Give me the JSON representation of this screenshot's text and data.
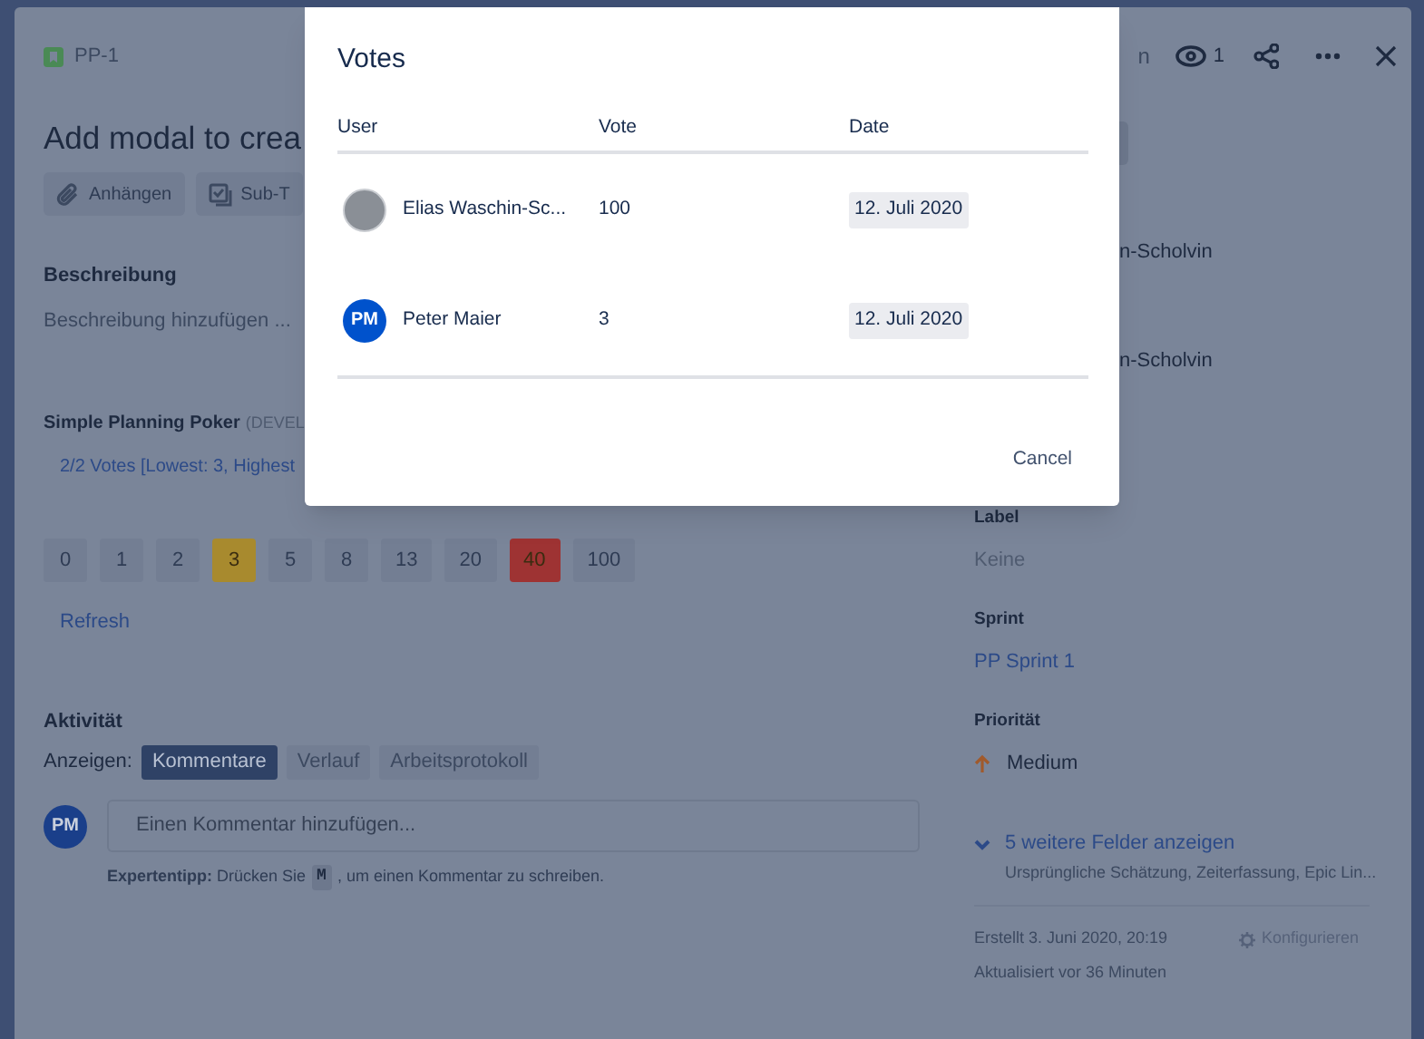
{
  "header": {
    "key": "PP-1",
    "partial_label": "n",
    "watchers": "1"
  },
  "issue": {
    "title": "Add modal to crea",
    "actions": [
      {
        "label": "Anhängen",
        "kind": "attach"
      },
      {
        "label": "Sub-T",
        "kind": "subtask"
      }
    ]
  },
  "description": {
    "heading": "Beschreibung",
    "placeholder": "Beschreibung hinzufügen ..."
  },
  "poker": {
    "heading": "Simple Planning Poker",
    "tag": "(DEVEL",
    "summary": "2/2 Votes [Lowest: 3, Highest",
    "refresh": "Refresh",
    "cards": [
      {
        "label": "0",
        "color": "#737e93"
      },
      {
        "label": "1",
        "color": "#737e93"
      },
      {
        "label": "2",
        "color": "#737e93"
      },
      {
        "label": "3",
        "color": "#a88a2e"
      },
      {
        "label": "5",
        "color": "#737e93"
      },
      {
        "label": "8",
        "color": "#737e93"
      },
      {
        "label": "13",
        "color": "#737e93"
      },
      {
        "label": "20",
        "color": "#737e93"
      },
      {
        "label": "40",
        "color": "#9e3333"
      },
      {
        "label": "100",
        "color": "#737e93"
      }
    ]
  },
  "activity": {
    "heading": "Aktivität",
    "show_label": "Anzeigen:",
    "filters": [
      {
        "label": "Kommentare",
        "selected": true
      },
      {
        "label": "Verlauf",
        "selected": false
      },
      {
        "label": "Arbeitsprotokoll",
        "selected": false
      }
    ],
    "avatar": "PM",
    "comment_placeholder": "Einen Kommentar hinzufügen...",
    "tip": "**Expertentipp:** Drücken Sie",
    "tip_key": "M",
    "tip_rest": ", um einen Kommentar zu schreiben."
  },
  "sidebar": {
    "assignee_partial": "n-Scholvin",
    "reporter_partial": "n-Scholvin",
    "fields": [
      {
        "label": "Label",
        "value": "Keine",
        "kind": "muted"
      },
      {
        "label": "Sprint",
        "value": "PP Sprint 1",
        "kind": "link"
      },
      {
        "label": "Priorität",
        "value": "Medium",
        "kind": "priority"
      }
    ],
    "more": {
      "label": "5 weitere Felder anzeigen",
      "hint": "Ursprüngliche Schätzung, Zeiterfassung, Epic Lin..."
    },
    "created": "Erstellt 3. Juni 2020, 20:19",
    "configure": "Konfigurieren",
    "updated": "Aktualisiert vor 36 Minuten"
  },
  "modal": {
    "title": "Votes",
    "columns": [
      "User",
      "Vote",
      "Date"
    ],
    "rows": [
      {
        "user": "Elias Waschin-Sc...",
        "avatar": {
          "kind": "photo"
        },
        "vote": "100",
        "date": "12. Juli 2020"
      },
      {
        "user": "Peter Maier",
        "avatar": {
          "kind": "initials",
          "text": "PM"
        },
        "vote": "3",
        "date": "12. Juli 2020"
      }
    ],
    "cancel": "Cancel"
  }
}
